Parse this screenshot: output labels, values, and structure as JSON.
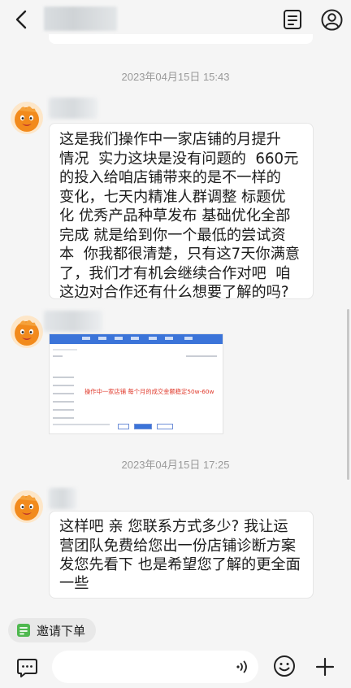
{
  "header": {
    "back_icon": "chevron-left-icon",
    "notes_icon": "notes-icon",
    "profile_icon": "profile-icon"
  },
  "messages": [
    {
      "timestamp": "2023年04月15日 15:43"
    },
    {
      "type": "text",
      "lines": [
        "这是我们操作中一家店铺的月提升",
        "情况  实力这块是没有问题的  660元",
        "的投入给咱店铺带来的是不一样的",
        "变化，七天内精准人群调整 标题优",
        "化 优秀产品种草发布 基础优化全部",
        "完成 就是给到你一个最低的尝试资",
        "本  你我都很清楚，只有这7天你满意",
        "了，我们才有机会继续合作对吧  咱",
        "这边对合作还有什么想要了解的吗?"
      ]
    },
    {
      "type": "image",
      "caption": "操作中一家店铺 每个月的成交金额稳定50w-60w"
    },
    {
      "timestamp": "2023年04月15日 17:25"
    },
    {
      "type": "text",
      "lines": [
        "这样吧 亲 您联系方式多少? 我让运",
        "营团队免费给您出一份店铺诊断方案",
        "发您先看下 也是希望您了解的更全面",
        "一些"
      ]
    }
  ],
  "invite_chip": {
    "label": "邀请下单"
  },
  "input_bar": {
    "chat_mode_icon": "chat-bubble-icon",
    "voice_icon": "voice-icon",
    "emoji_icon": "emoji-icon",
    "plus_icon": "plus-icon",
    "placeholder": ""
  },
  "colors": {
    "background": "#f5f5f5",
    "bubble": "#ffffff",
    "timestamp": "#9a9a9a",
    "invite_icon": "#4fb84f",
    "avatar_orange": "#f28a1c"
  }
}
